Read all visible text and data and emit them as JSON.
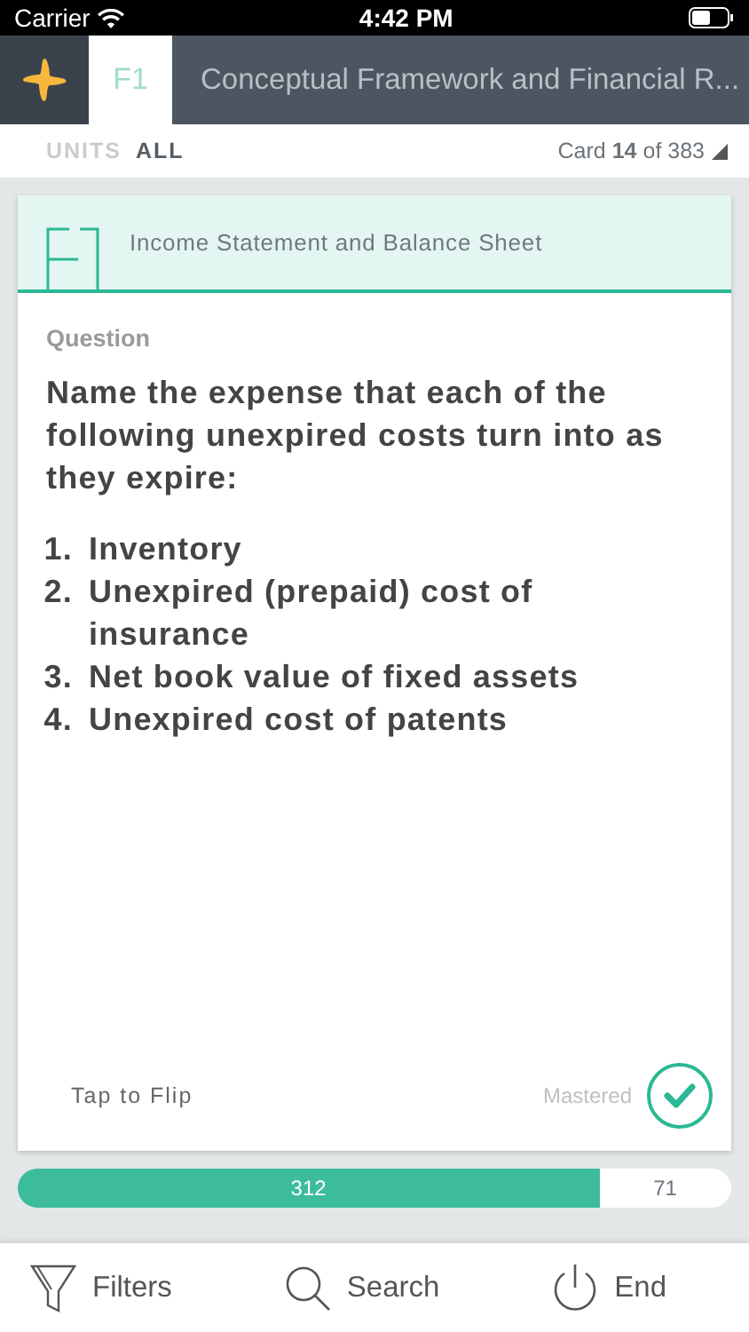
{
  "status_bar": {
    "carrier": "Carrier",
    "time": "4:42 PM"
  },
  "header": {
    "tab": {
      "label": "F1",
      "selected": true
    },
    "title": "Conceptual Framework and Financial R..."
  },
  "filter_bar": {
    "units_label": "UNITS",
    "units_value": "ALL",
    "card_prefix": "Card",
    "card_number": "14",
    "card_total": "of 383"
  },
  "card": {
    "topic": "Income Statement and Balance Sheet",
    "section": "Question",
    "prompt": "Name the expense that each of the following unexpired costs turn into as they expire:",
    "items": [
      {
        "number": "1.",
        "text": "Inventory"
      },
      {
        "number": "2.",
        "text": "Unexpired (prepaid) cost of insurance"
      },
      {
        "number": "3.",
        "text": "Net book value of fixed assets"
      },
      {
        "number": "4.",
        "text": "Unexpired cost of patents"
      }
    ],
    "flip_hint": "Tap to Flip",
    "mastered_label": "Mastered",
    "mastered": false
  },
  "progress": {
    "level": 0.815,
    "done": "312",
    "remaining": "71"
  },
  "toolbar": [
    {
      "kind": "filter",
      "label": "Filters"
    },
    {
      "kind": "search",
      "label": "Search"
    },
    {
      "kind": "end",
      "label": "End"
    }
  ]
}
